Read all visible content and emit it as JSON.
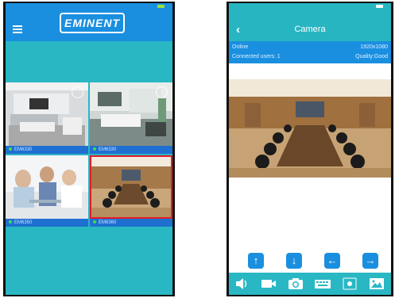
{
  "left_app": {
    "logo_text": "EMINENT",
    "cameras": [
      {
        "label": "EM6330",
        "scene": "living-room-1"
      },
      {
        "label": "EM6330",
        "scene": "living-room-2"
      },
      {
        "label": "EM6350",
        "scene": "office-meeting"
      },
      {
        "label": "EM6360",
        "scene": "conference-room",
        "selected": true
      }
    ]
  },
  "right_app": {
    "title": "Camera",
    "status": "Online",
    "resolution": "1920x1080",
    "connected_users": "Connected users: 1",
    "quality": "Quality:Good",
    "ptz_controls": [
      "up-arrow-icon",
      "down-arrow-icon",
      "left-arrow-icon",
      "right-arrow-icon"
    ],
    "toolbar_icons": [
      "speaker-icon",
      "video-record-icon",
      "camera-snapshot-icon",
      "keyboard-icon",
      "zoom-icon",
      "gallery-icon"
    ]
  },
  "colors": {
    "app_blue": "#1a8fe0",
    "teal_background": "#29b7c4",
    "selection_red": "#e21d2a",
    "online_green": "#3ee04f"
  }
}
